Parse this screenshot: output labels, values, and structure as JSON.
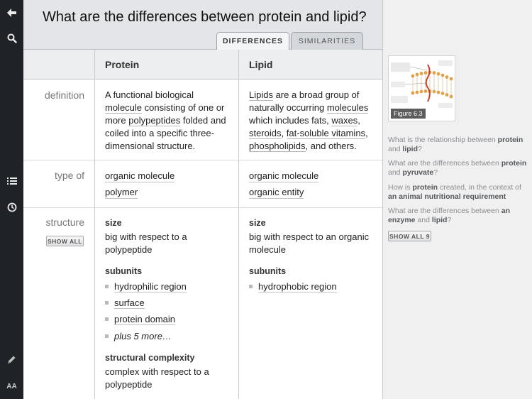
{
  "toolbar": {
    "icons": [
      "back-arrow-icon",
      "search-icon",
      "list-icon",
      "clock-icon",
      "pencil-icon",
      "font-size-icon"
    ],
    "font_size_label": "AA"
  },
  "header": {
    "question": "What are the differences between protein and lipid?",
    "tabs": [
      {
        "label": "DIFFERENCES",
        "active": true
      },
      {
        "label": "SIMILARITIES",
        "active": false
      }
    ]
  },
  "table": {
    "columns": [
      "Protein",
      "Lipid"
    ],
    "rows": {
      "definition": {
        "label": "definition",
        "protein": {
          "l1a": "A functional biological",
          "l2a": "molecule",
          "l2b": " consisting of one or",
          "l3a": "more ",
          "l3b": "polypeptides",
          "l3c": " folded and",
          "l4": "coiled into a specific three-",
          "l5": "dimensional structure."
        },
        "lipid": {
          "l1a": "Lipids",
          "l1b": " are a broad group of",
          "l2a": "naturally occurring ",
          "l2b": "molecules",
          "l3a": "which includes fats, ",
          "l3b": "waxes",
          "l4a": "steroids",
          "l4b": "fat-soluble vitamins",
          "l5a": "phospholipids",
          "l5b": ", and others.",
          "comma": ","
        }
      },
      "type_of": {
        "label": "type of",
        "protein": [
          "organic molecule",
          "polymer"
        ],
        "lipid": [
          "organic molecule",
          "organic entity"
        ]
      },
      "structure": {
        "label": "structure",
        "show_all": "SHOW ALL",
        "protein": {
          "size_heading": "size",
          "size_l1": "big with respect to a",
          "size_l2": "polypeptide",
          "subunits_heading": "subunits",
          "subunits": [
            "hydrophilic region",
            "surface",
            "protein domain"
          ],
          "more": "plus 5 more…",
          "complexity_heading": "structural complexity",
          "complexity_l1": "complex with respect to a",
          "complexity_l2": "polypeptide"
        },
        "lipid": {
          "size_heading": "size",
          "size_l1": "big with respect to an organic",
          "size_l2": "molecule",
          "subunits_heading": "subunits",
          "subunits": [
            "hydrophobic region"
          ]
        }
      }
    }
  },
  "sidebar": {
    "figure_label": "Figure 6.3",
    "related": [
      {
        "pre": "What is the relationship between ",
        "b1": "protein",
        "mid": " and ",
        "b2": "lipid",
        "post": "?"
      },
      {
        "pre": "What are the differences between ",
        "b1": "protein",
        "mid": " and ",
        "b2": "pyruvate",
        "post": "?"
      },
      {
        "pre": "How is ",
        "b1": "protein",
        "mid": " created, in the context of ",
        "b2": "an animal nutritional requirement",
        "post": ""
      },
      {
        "pre": "What are the differences between ",
        "b1": "an enzyme",
        "mid": " and ",
        "b2": "lipid",
        "post": "?"
      }
    ],
    "show_all": "SHOW ALL 9"
  },
  "colors": {
    "toolbar_bg": "#1f2226",
    "header_bg": "#e3e5e8",
    "sidebar_bg": "#f0f0f0"
  }
}
